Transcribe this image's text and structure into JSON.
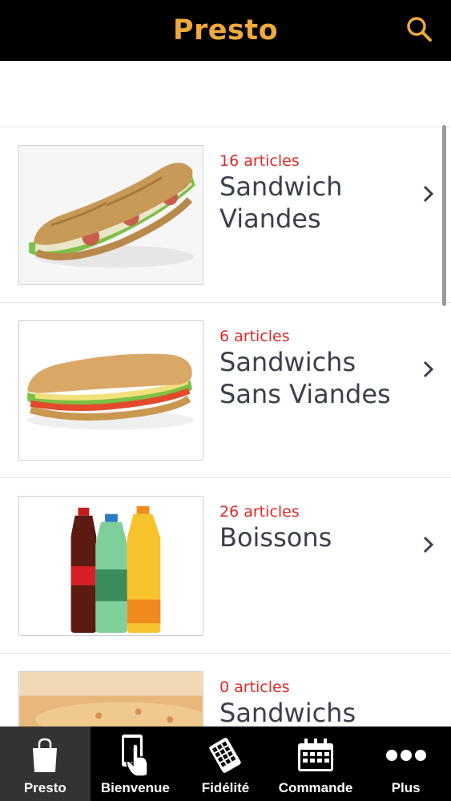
{
  "header": {
    "title": "Presto",
    "search_icon": "search-icon",
    "accent_color": "#f0a93a"
  },
  "categories": [
    {
      "count": "16 articles",
      "name": "Sandwich Viandes",
      "image": "meat-sandwich-image"
    },
    {
      "count": "6 articles",
      "name": "Sandwichs Sans Viandes",
      "image": "veggie-sandwich-image"
    },
    {
      "count": "26 articles",
      "name": "Boissons",
      "image": "drinks-image"
    },
    {
      "count": "0 articles",
      "name": "Sandwichs",
      "image": "hot-sandwich-image"
    }
  ],
  "tabbar": {
    "items": [
      {
        "label": "Presto",
        "icon": "shopping-bag-icon",
        "active": true
      },
      {
        "label": "Bienvenue",
        "icon": "touch-phone-icon",
        "active": false
      },
      {
        "label": "Fidélité",
        "icon": "loyalty-card-icon",
        "active": false
      },
      {
        "label": "Commande",
        "icon": "calendar-icon",
        "active": false
      },
      {
        "label": "Plus",
        "icon": "more-icon",
        "active": false
      }
    ]
  },
  "colors": {
    "count_red": "#e02a2a",
    "text_dark": "#3b3f4a",
    "bar_black": "#000000"
  }
}
